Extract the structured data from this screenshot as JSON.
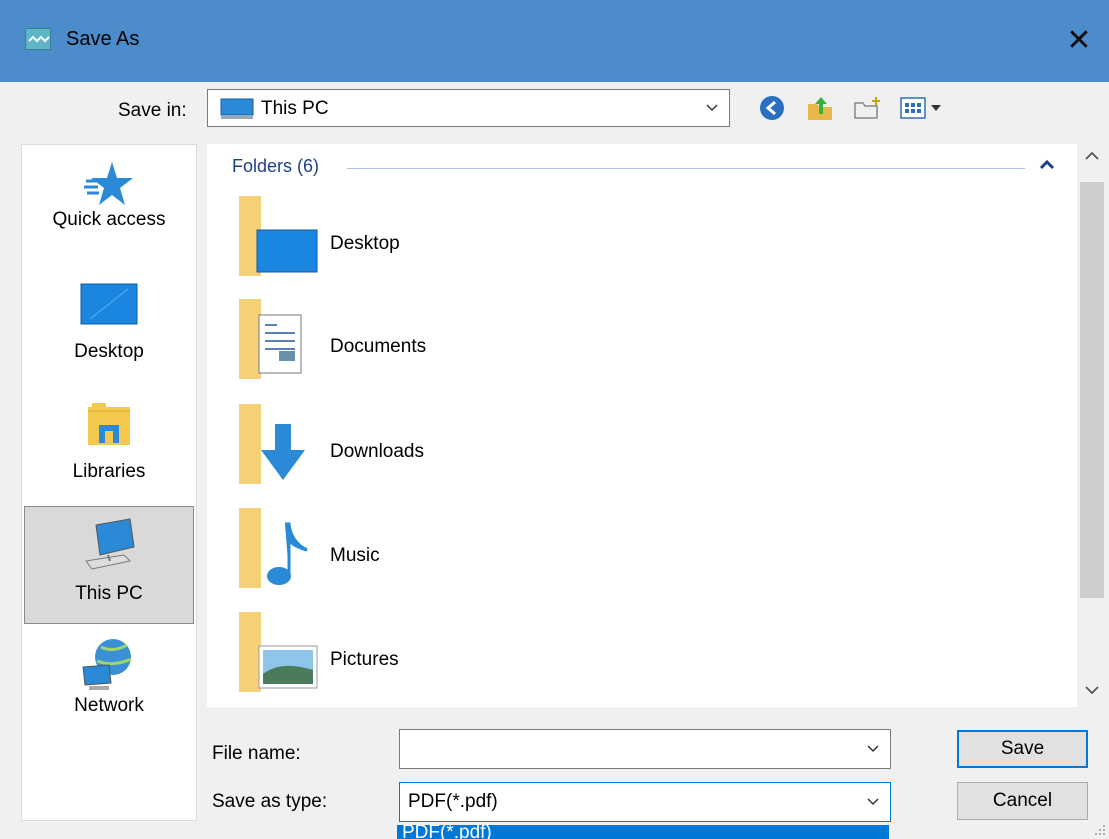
{
  "window": {
    "title": "Save As",
    "close_glyph": "✕"
  },
  "toolbar": {
    "save_in_label": "Save in:",
    "save_in_value": "This PC",
    "icons": [
      "back-icon",
      "up-folder-icon",
      "new-folder-icon",
      "view-menu-icon"
    ]
  },
  "sidebar": {
    "items": [
      {
        "label": "Quick access",
        "icon": "star-icon"
      },
      {
        "label": "Desktop",
        "icon": "desktop-icon"
      },
      {
        "label": "Libraries",
        "icon": "libraries-icon"
      },
      {
        "label": "This PC",
        "icon": "computer-icon",
        "selected": true
      },
      {
        "label": "Network",
        "icon": "network-icon"
      }
    ]
  },
  "filelist": {
    "group_header": "Folders (6)",
    "items": [
      {
        "label": "Desktop",
        "icon": "desktop-folder-icon"
      },
      {
        "label": "Documents",
        "icon": "documents-folder-icon"
      },
      {
        "label": "Downloads",
        "icon": "downloads-folder-icon"
      },
      {
        "label": "Music",
        "icon": "music-folder-icon"
      },
      {
        "label": "Pictures",
        "icon": "pictures-folder-icon"
      }
    ]
  },
  "form": {
    "file_name_label": "File name:",
    "file_name_value": "",
    "save_type_label": "Save as type:",
    "save_type_value": "PDF(*.pdf)",
    "dropdown_option": "PDF(*.pdf)"
  },
  "buttons": {
    "save": "Save",
    "cancel": "Cancel"
  },
  "colors": {
    "titlebar": "#4d8ccb",
    "accent": "#0078d7",
    "group_header": "#1e3f8a"
  }
}
